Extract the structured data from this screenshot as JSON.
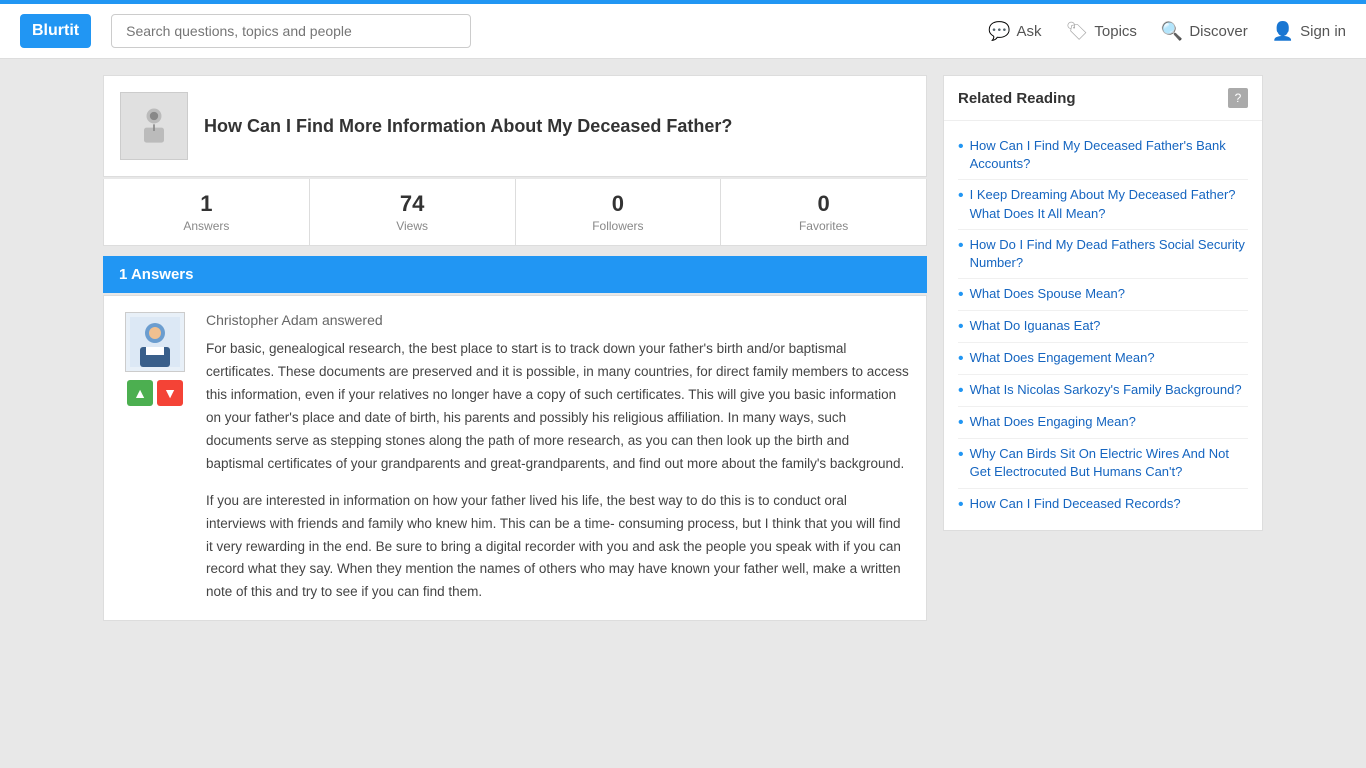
{
  "topbar": {},
  "header": {
    "logo": "Blurtit",
    "search_placeholder": "Search questions, topics and people",
    "nav": [
      {
        "id": "ask",
        "label": "Ask",
        "icon": "💬"
      },
      {
        "id": "topics",
        "label": "Topics",
        "icon": "🏷"
      },
      {
        "id": "discover",
        "label": "Discover",
        "icon": "🔍"
      },
      {
        "id": "signin",
        "label": "Sign in",
        "icon": "👤"
      }
    ]
  },
  "question": {
    "title": "How Can I Find More Information About My Deceased Father?",
    "stats": [
      {
        "id": "answers",
        "number": "1",
        "label": "Answers"
      },
      {
        "id": "views",
        "number": "74",
        "label": "Views"
      },
      {
        "id": "followers",
        "number": "0",
        "label": "Followers"
      },
      {
        "id": "favorites",
        "number": "0",
        "label": "Favorites"
      }
    ]
  },
  "answers_header": "1 Answers",
  "answer": {
    "author": "Christopher Adam",
    "action": "answered",
    "paragraphs": [
      "For basic, genealogical research, the best place to start is to track down your father's birth and/or baptismal certificates. These documents are preserved and it is possible, in many countries, for direct family members to access this information, even if your relatives no longer have a copy of such certificates. This will give you basic information on your father's place and date of birth, his parents and possibly his religious affiliation. In many ways, such documents serve as stepping stones along the path of more research, as you can then look up the birth and baptismal certificates of your grandparents and great-grandparents, and find out more about the family's background.",
      "If you are interested in information on how your father lived his life, the best way to do this is to conduct oral interviews with friends and family who knew him. This can be a time- consuming process, but I think that you will find it very rewarding in the end. Be sure to bring a digital recorder with you and ask the people you speak with if you can record what they say. When they mention the names of others who may have known your father well, make a written note of this and try to see if you can find them."
    ]
  },
  "related_reading": {
    "title": "Related Reading",
    "links": [
      "How Can I Find My Deceased Father's Bank Accounts?",
      "I Keep Dreaming About My Deceased Father? What Does It All Mean?",
      "How Do I Find My Dead Fathers Social Security Number?",
      "What Does Spouse Mean?",
      "What Do Iguanas Eat?",
      "What Does Engagement Mean?",
      "What Is Nicolas Sarkozy's Family Background?",
      "What Does Engaging Mean?",
      "Why Can Birds Sit On Electric Wires And Not Get Electrocuted But Humans Can't?",
      "How Can I Find Deceased Records?"
    ]
  }
}
